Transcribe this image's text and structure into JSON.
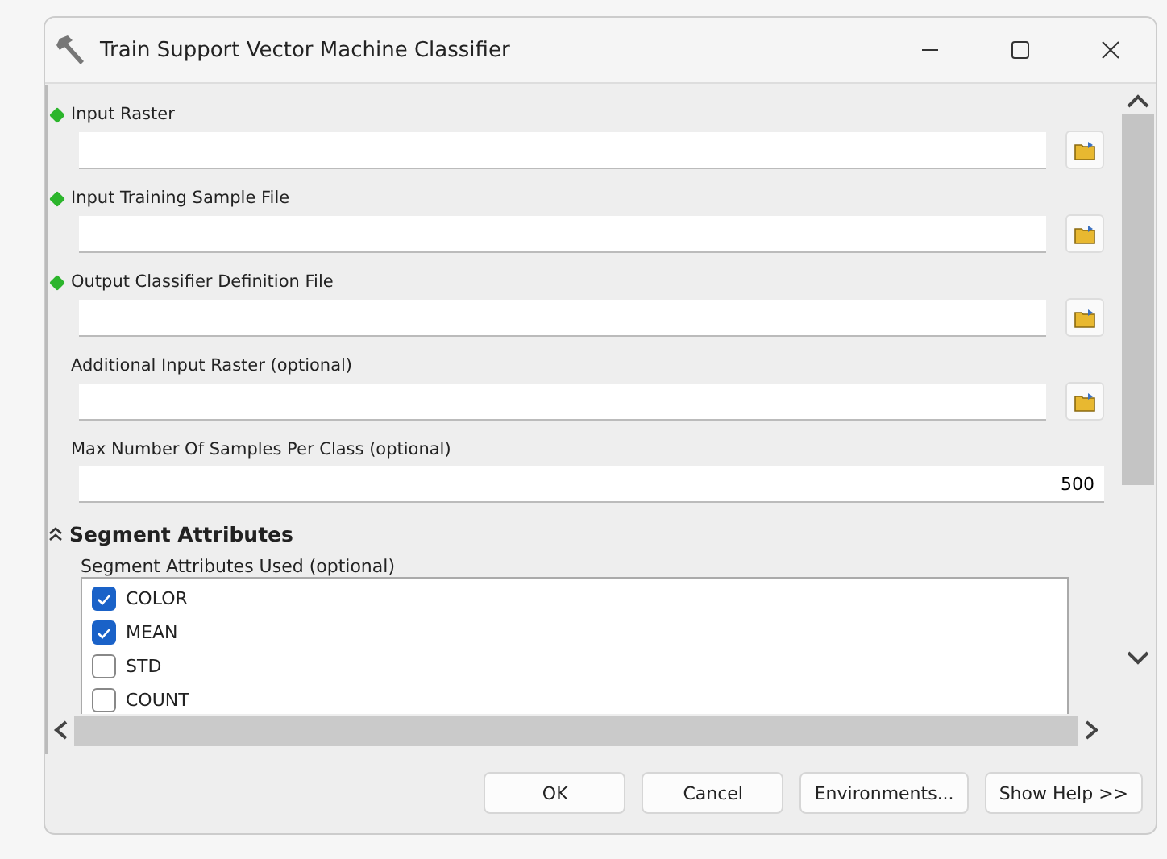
{
  "window": {
    "title": "Train Support Vector Machine Classifier"
  },
  "parameters": [
    {
      "kind": "file",
      "label": "Input Raster",
      "required": true
    },
    {
      "kind": "file",
      "label": "Input Training Sample File",
      "required": true
    },
    {
      "kind": "file",
      "label": "Output Classifier Definition File",
      "required": true
    },
    {
      "kind": "file",
      "label": "Additional Input Raster (optional)",
      "required": false
    },
    {
      "kind": "number",
      "label": "Max Number Of Samples Per Class (optional)",
      "required": false,
      "value": "500"
    }
  ],
  "section": {
    "title": "Segment Attributes",
    "expanded": true,
    "label": "Segment Attributes Used (optional)",
    "items": [
      {
        "label": "COLOR",
        "checked": true
      },
      {
        "label": "MEAN",
        "checked": true
      },
      {
        "label": "STD",
        "checked": false
      },
      {
        "label": "COUNT",
        "checked": false
      }
    ]
  },
  "buttons": [
    "OK",
    "Cancel",
    "Environments...",
    "Show Help >>"
  ]
}
